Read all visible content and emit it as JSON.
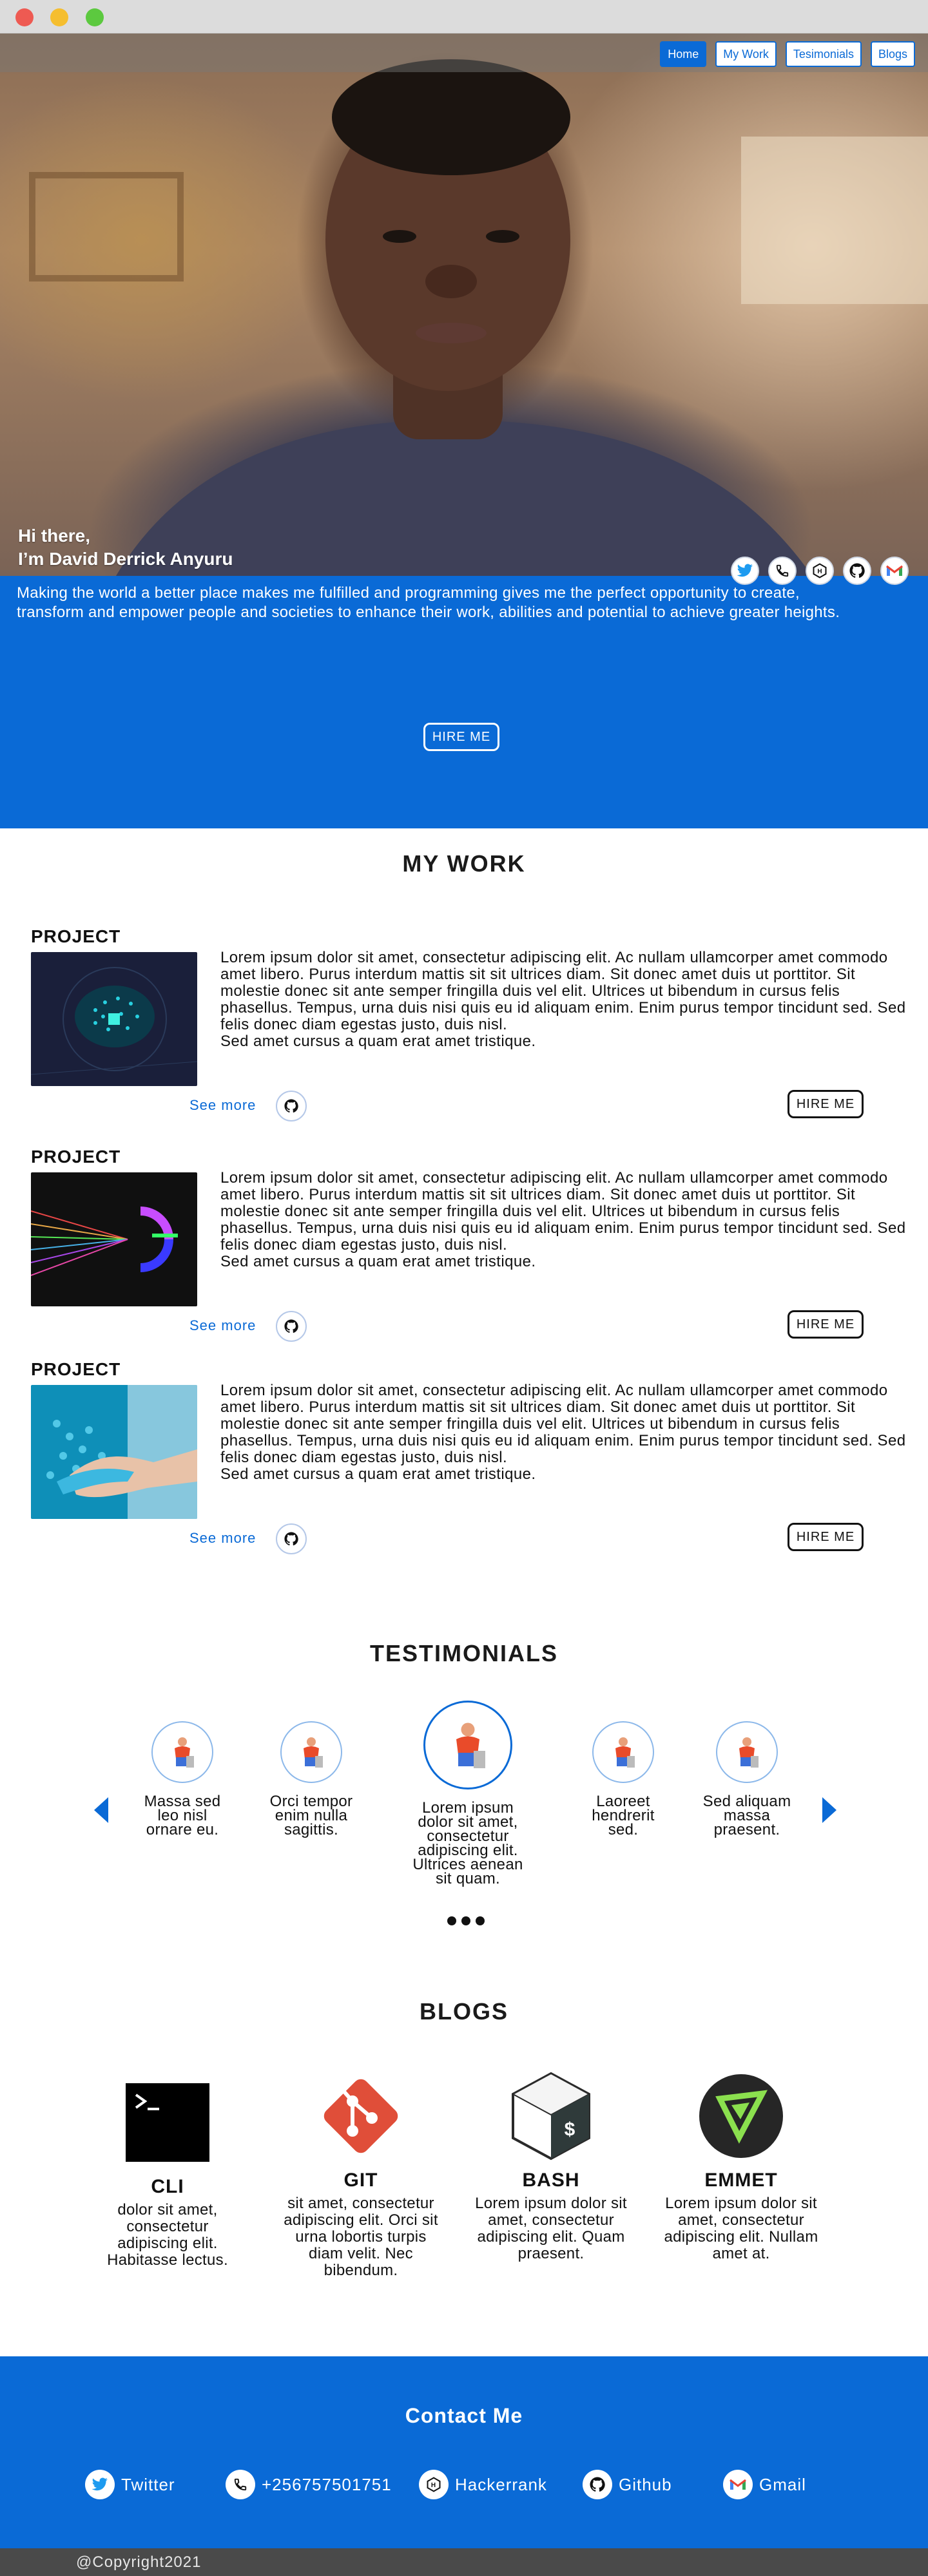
{
  "nav": {
    "items": [
      {
        "label": "Home"
      },
      {
        "label": "My Work"
      },
      {
        "label": "Tesimonials"
      },
      {
        "label": "Blogs"
      }
    ]
  },
  "hero": {
    "greeting_line1": "Hi there,",
    "greeting_line2": "I’m David Derrick Anyuru",
    "description": "Making the world a better place makes me fulfilled and programming gives me the perfect opportunity to create, transform and empower people and societies to enhance their work, abilities and potential to achieve greater heights.",
    "hire_label": "HIRE ME",
    "social_icons": [
      "twitter-icon",
      "phone-icon",
      "hackerrank-icon",
      "github-icon",
      "gmail-icon"
    ]
  },
  "work": {
    "title": "MY WORK",
    "projects": [
      {
        "label": "PROJECT",
        "image": "ai-brain-image",
        "text": "Lorem ipsum dolor sit amet, consectetur adipiscing elit. Ac nullam ullamcorper amet commodo amet libero. Purus interdum mattis sit sit ultrices diam. Sit donec amet duis ut porttitor. Sit molestie donec sit ante semper fringilla duis vel elit. Ultrices ut bibendum in cursus felis phasellus. Tempus, urna duis nisi quis eu id aliquam enim. Enim purus tempor tincidunt sed. Sed felis donec diam egestas justo, duis nisl.\nSed amet cursus a quam erat amet tristique.",
        "see_more": "See more",
        "hire_label": "HIRE ME"
      },
      {
        "label": "PROJECT",
        "image": "light-prism-image",
        "text": "Lorem ipsum dolor sit amet, consectetur adipiscing elit. Ac nullam ullamcorper amet commodo amet libero. Purus interdum mattis sit sit ultrices diam. Sit donec amet duis ut porttitor. Sit molestie donec sit ante semper fringilla duis vel elit. Ultrices ut bibendum in cursus felis phasellus. Tempus, urna duis nisi quis eu id aliquam enim. Enim purus tempor tincidunt sed. Sed felis donec diam egestas justo, duis nisl.\nSed amet cursus a quam erat amet tristique.",
        "see_more": "See more",
        "hire_label": "HIRE ME"
      },
      {
        "label": "PROJECT",
        "image": "robot-handshake-image",
        "text": "Lorem ipsum dolor sit amet, consectetur adipiscing elit. Ac nullam ullamcorper amet commodo amet libero. Purus interdum mattis sit sit ultrices diam. Sit donec amet duis ut porttitor. Sit molestie donec sit ante semper fringilla duis vel elit. Ultrices ut bibendum in cursus felis phasellus. Tempus, urna duis nisi quis eu id aliquam enim. Enim purus tempor tincidunt sed. Sed felis donec diam egestas justo, duis nisl.\nSed amet cursus a quam erat amet tristique.",
        "see_more": "See more",
        "hire_label": "HIRE ME"
      }
    ]
  },
  "testimonials": {
    "title": "TESTIMONIALS",
    "items": [
      {
        "quote": "Massa sed leo nisl ornare eu."
      },
      {
        "quote": "Orci tempor enim nulla sagittis."
      },
      {
        "quote": "Lorem ipsum dolor sit amet, consectetur adipiscing elit. Ultrices aenean sit quam."
      },
      {
        "quote": "Laoreet hendrerit sed."
      },
      {
        "quote": "Sed aliquam massa praesent."
      }
    ]
  },
  "blogs": {
    "title": "BLOGS",
    "items": [
      {
        "name": "CLI",
        "icon": "terminal-icon",
        "desc": "dolor sit amet, consectetur adipiscing elit. Habitasse lectus."
      },
      {
        "name": "GIT",
        "icon": "git-icon",
        "desc": "sit amet, consectetur adipiscing elit. Orci sit urna lobortis turpis diam velit. Nec bibendum."
      },
      {
        "name": "BASH",
        "icon": "bash-icon",
        "desc": "Lorem ipsum dolor sit amet, consectetur adipiscing elit. Quam praesent."
      },
      {
        "name": "EMMET",
        "icon": "emmet-icon",
        "desc": "Lorem ipsum dolor sit amet, consectetur adipiscing elit. Nullam amet at."
      }
    ]
  },
  "contact": {
    "title": "Contact Me",
    "items": [
      {
        "label": "Twitter",
        "icon": "twitter-icon"
      },
      {
        "label": "+256757501751",
        "icon": "phone-icon"
      },
      {
        "label": "Hackerrank",
        "icon": "hackerrank-icon"
      },
      {
        "label": "Github",
        "icon": "github-icon"
      },
      {
        "label": "Gmail",
        "icon": "gmail-icon"
      }
    ]
  },
  "footer": {
    "copyright": "@Copyright2021"
  },
  "colors": {
    "brand_blue": "#0a6ad6",
    "footer_bar": "#4a4a4a"
  }
}
